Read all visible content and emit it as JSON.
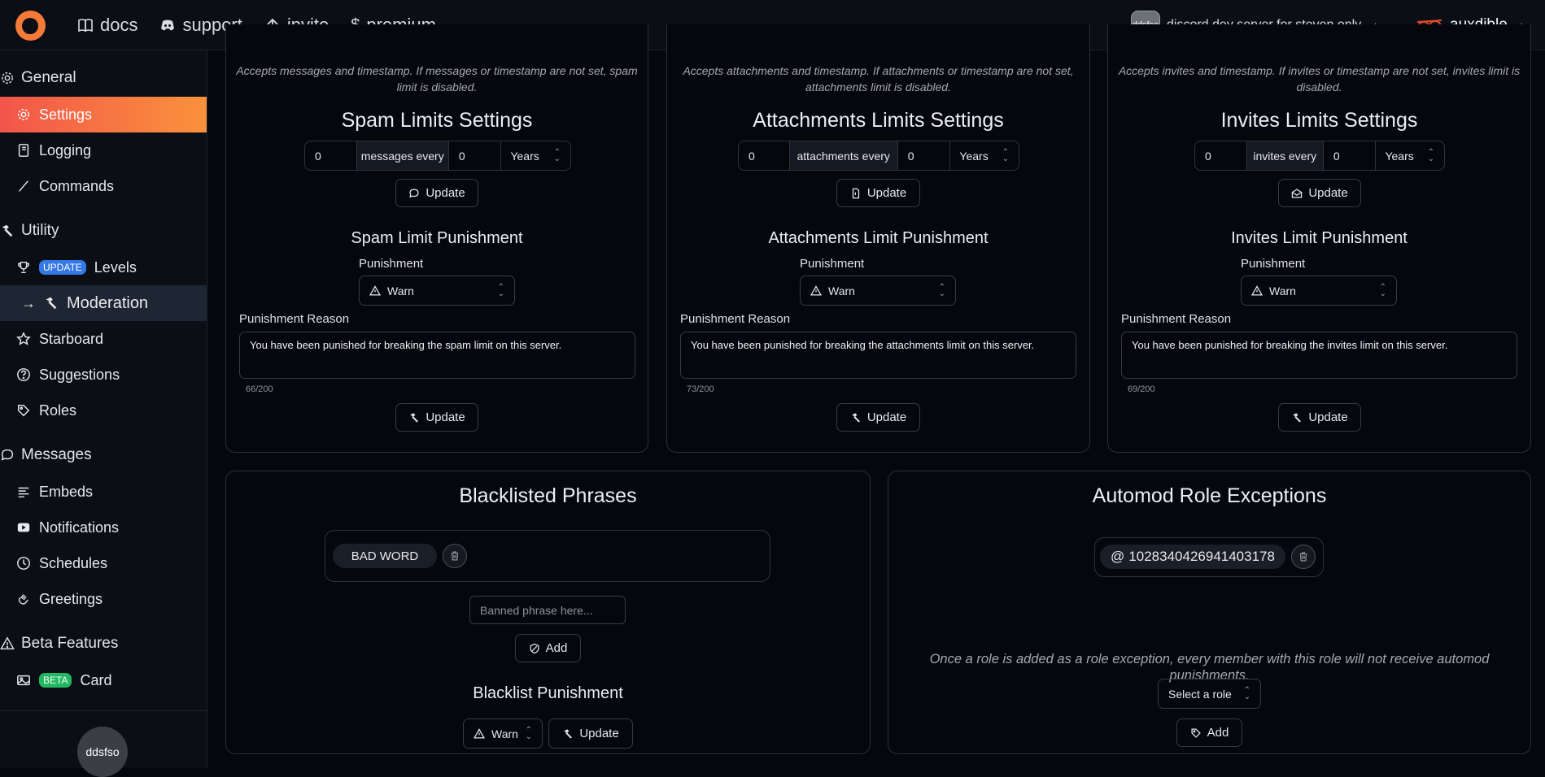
{
  "nav": {
    "docs": "docs",
    "support": "support",
    "invite": "invite",
    "premium": "premium",
    "server_avatar": "ddsfso",
    "server_name": "discord dev server for steven only",
    "username": "auxdible"
  },
  "sidebar": {
    "general": "General",
    "settings": "Settings",
    "logging": "Logging",
    "commands": "Commands",
    "utility": "Utility",
    "levels_badge": "UPDATE",
    "levels": "Levels",
    "moderation": "Moderation",
    "starboard": "Starboard",
    "suggestions": "Suggestions",
    "roles": "Roles",
    "messages": "Messages",
    "embeds": "Embeds",
    "notifications": "Notifications",
    "schedules": "Schedules",
    "greetings": "Greetings",
    "beta_features": "Beta Features",
    "card_badge": "BETA",
    "card": "Card",
    "avatar": "ddsfso"
  },
  "spam": {
    "desc": "Accepts messages and timestamp. If messages or timestamp are not set, spam limit is disabled.",
    "title": "Spam Limits Settings",
    "count": "0",
    "unit_label": "messages every",
    "interval": "0",
    "period": "Years",
    "update": "Update",
    "punish_title": "Spam Limit Punishment",
    "punish_label": "Punishment",
    "punish_value": "Warn",
    "reason_label": "Punishment Reason",
    "reason": "You have been punished for breaking the spam limit on this server.",
    "counter": "66/200",
    "update2": "Update"
  },
  "attach": {
    "desc": "Accepts attachments and timestamp. If attachments or timestamp are not set, attachments limit is disabled.",
    "title": "Attachments Limits Settings",
    "count": "0",
    "unit_label": "attachments every",
    "interval": "0",
    "period": "Years",
    "update": "Update",
    "punish_title": "Attachments Limit Punishment",
    "punish_label": "Punishment",
    "punish_value": "Warn",
    "reason_label": "Punishment Reason",
    "reason": "You have been punished for breaking the attachments limit on this server.",
    "counter": "73/200",
    "update2": "Update"
  },
  "invites": {
    "desc": "Accepts invites and timestamp. If invites or timestamp are not set, invites limit is disabled.",
    "title": "Invites Limits Settings",
    "count": "0",
    "unit_label": "invites every",
    "interval": "0",
    "period": "Years",
    "update": "Update",
    "punish_title": "Invites Limit Punishment",
    "punish_label": "Punishment",
    "punish_value": "Warn",
    "reason_label": "Punishment Reason",
    "reason": "You have been punished for breaking the invites limit on this server.",
    "counter": "69/200",
    "update2": "Update"
  },
  "blacklist": {
    "title": "Blacklisted Phrases",
    "phrases": [
      "BAD WORD"
    ],
    "placeholder": "Banned phrase here...",
    "add": "Add",
    "punish_title": "Blacklist Punishment",
    "punish_value": "Warn",
    "update": "Update"
  },
  "exceptions": {
    "title": "Automod Role Exceptions",
    "role_prefix": "@",
    "role_id": "1028340426941403178",
    "note": "Once a role is added as a role exception, every member with this role will not receive automod punishments.",
    "select": "Select a role",
    "add": "Add"
  }
}
